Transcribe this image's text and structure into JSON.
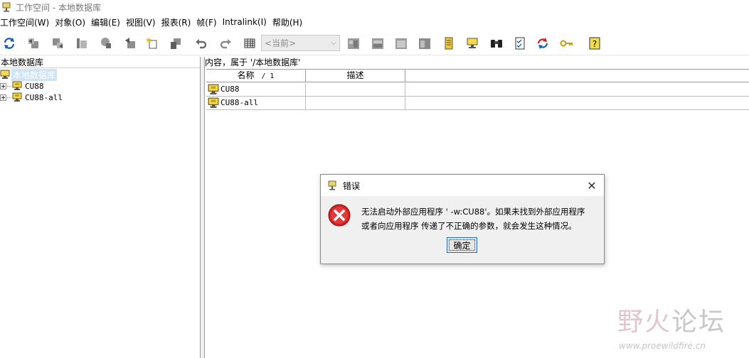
{
  "window": {
    "title": "工作空间 - 本地数据库"
  },
  "menu": [
    "工作空间(W)",
    "对象(O)",
    "编辑(E)",
    "视图(V)",
    "报表(R)",
    "帧(F)",
    "Intralink(I)",
    "帮助(H)"
  ],
  "toolbar": {
    "combo_value": "<当前>",
    "icons": [
      "refresh-icon",
      "check-in-icon",
      "check-out-icon",
      "column-icon",
      "locate-icon",
      "update-icon",
      "new-object-icon",
      "copy-icon",
      "undo-icon",
      "redo-icon",
      "grid-icon",
      "window-1-icon",
      "window-2-icon",
      "window-3-icon",
      "window-4-icon",
      "report-icon",
      "database-icon",
      "binoculars-icon",
      "checklist-icon",
      "sync-icon",
      "key-icon",
      "help-icon"
    ]
  },
  "left_pane": {
    "header": "本地数据库",
    "tree": {
      "root": "本地数据库",
      "children": [
        "CU88",
        "CU88-all"
      ]
    }
  },
  "right_pane": {
    "header": "内容，属于 '/本地数据库'",
    "columns": {
      "name": "名称",
      "sort_indicator": "/ 1",
      "desc": "描述"
    },
    "rows": [
      {
        "name": "CU88",
        "desc": ""
      },
      {
        "name": "CU88-all",
        "desc": ""
      }
    ]
  },
  "dialog": {
    "title": "错误",
    "message_line1": "无法启动外部应用程序 ' -w:CU88'。如果未找到外部应用程序",
    "message_line2": "或者向应用程序 传递了不正确的参数，就会发生这种情况。",
    "ok_label": "确定"
  },
  "watermark": {
    "text_a": "野火",
    "text_b": "论坛",
    "url": "www.proewildfire.cn"
  },
  "colors": {
    "selection": "#cfe3f7",
    "error_red": "#d21f1f",
    "focus_border": "#1e6fd0"
  }
}
